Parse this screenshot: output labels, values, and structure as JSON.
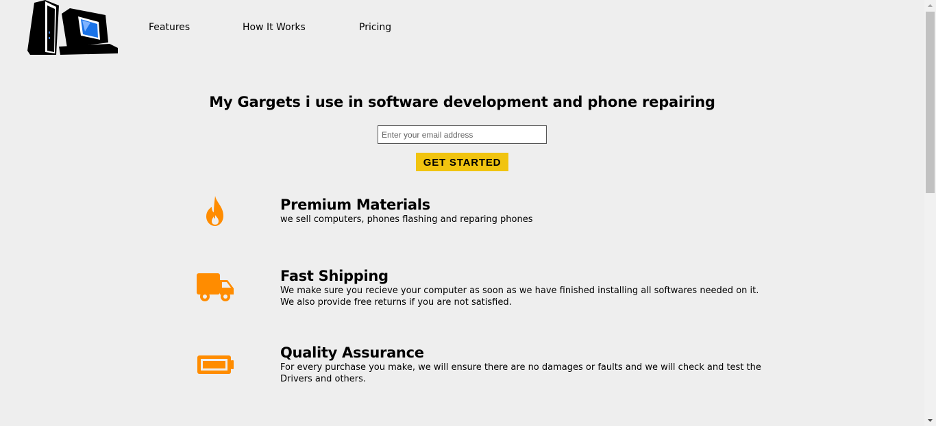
{
  "header": {
    "logo_icon": "computer-tower-monitor-logo",
    "nav": [
      {
        "label": "Features"
      },
      {
        "label": "How It Works"
      },
      {
        "label": "Pricing"
      }
    ]
  },
  "hero": {
    "title": "My Gargets i use in software development and phone repairing",
    "email_placeholder": "Enter your email address",
    "email_value": "",
    "cta_label": "GET STARTED"
  },
  "features": [
    {
      "icon": "fire-icon",
      "title": "Premium Materials",
      "description": "we sell computers, phones flashing and reparing phones"
    },
    {
      "icon": "truck-icon",
      "title": "Fast Shipping",
      "description": "We make sure you recieve your computer as soon as we have finished installing all softwares needed on it. We also provide free returns if you are not satisfied."
    },
    {
      "icon": "battery-icon",
      "title": "Quality Assurance",
      "description": "For every purchase you make, we will ensure there are no damages or faults and we will check and test the Drivers and others."
    }
  ],
  "colors": {
    "background": "#eeeeee",
    "accent_button": "#f1c40f",
    "icon_orange": "#ff8c00",
    "text": "#000000"
  }
}
